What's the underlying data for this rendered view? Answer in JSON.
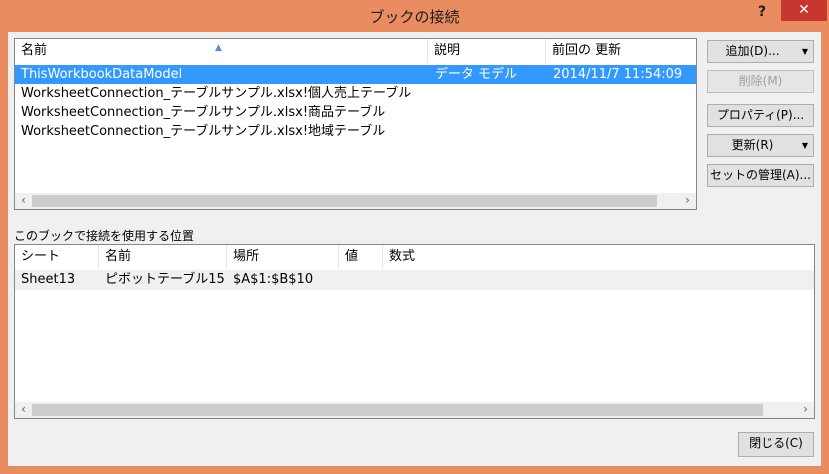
{
  "window": {
    "title": "ブックの接続",
    "help_glyph": "?",
    "close_glyph": "✕"
  },
  "connections": {
    "columns": [
      "名前",
      "説明",
      "前回の 更新"
    ],
    "rows": [
      {
        "name": "ThisWorkbookDataModel",
        "description": "データ モデル",
        "last_refresh": "2014/11/7  11:54:09"
      },
      {
        "name": "WorksheetConnection_テーブルサンプル.xlsx!個人売上テーブル",
        "description": "",
        "last_refresh": ""
      },
      {
        "name": "WorksheetConnection_テーブルサンプル.xlsx!商品テーブル",
        "description": "",
        "last_refresh": ""
      },
      {
        "name": "WorksheetConnection_テーブルサンプル.xlsx!地域テーブル",
        "description": "",
        "last_refresh": ""
      }
    ]
  },
  "buttons": {
    "add": "追加(D)...",
    "delete": "削除(M)",
    "properties": "プロパティ(P)...",
    "refresh": "更新(R)",
    "manage_sets": "セットの管理(A)...",
    "close": "閉じる(C)"
  },
  "usage": {
    "label": "このブックで接続を使用する位置",
    "columns": [
      "シート",
      "名前",
      "場所",
      "値",
      "数式"
    ],
    "rows": [
      {
        "sheet": "Sheet13",
        "name": "ピボットテーブル15",
        "location": "$A$1:$B$10",
        "value": "",
        "formula": ""
      }
    ]
  },
  "scroll": {
    "left_glyph": "‹",
    "right_glyph": "›"
  }
}
